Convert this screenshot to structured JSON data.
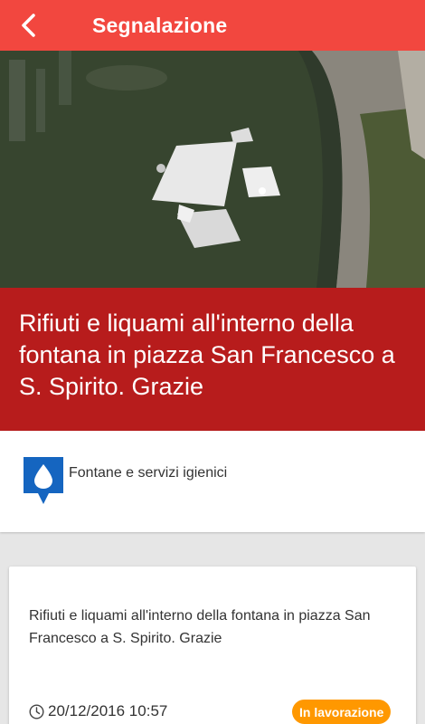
{
  "header": {
    "title": "Segnalazione",
    "back_icon": "chevron-left-icon",
    "background_color": "#f2473f"
  },
  "report": {
    "photo_description_icon": "fountain-photo",
    "title": "Rifiuti e liquami all'interno della fontana in piazza San Francesco a S. Spirito. Grazie",
    "title_background_color": "#b71c1c",
    "category": {
      "icon": "water-drop-marker-icon",
      "label": "Fontane e servizi igienici",
      "icon_color": "#1565c0"
    },
    "description": "Rifiuti e liquami all'interno della fontana in piazza San Francesco a S. Spirito. Grazie",
    "date": "20/12/2016 10:57",
    "date_icon": "clock-icon",
    "status": "In lavorazione",
    "status_color": "#ff9800"
  }
}
